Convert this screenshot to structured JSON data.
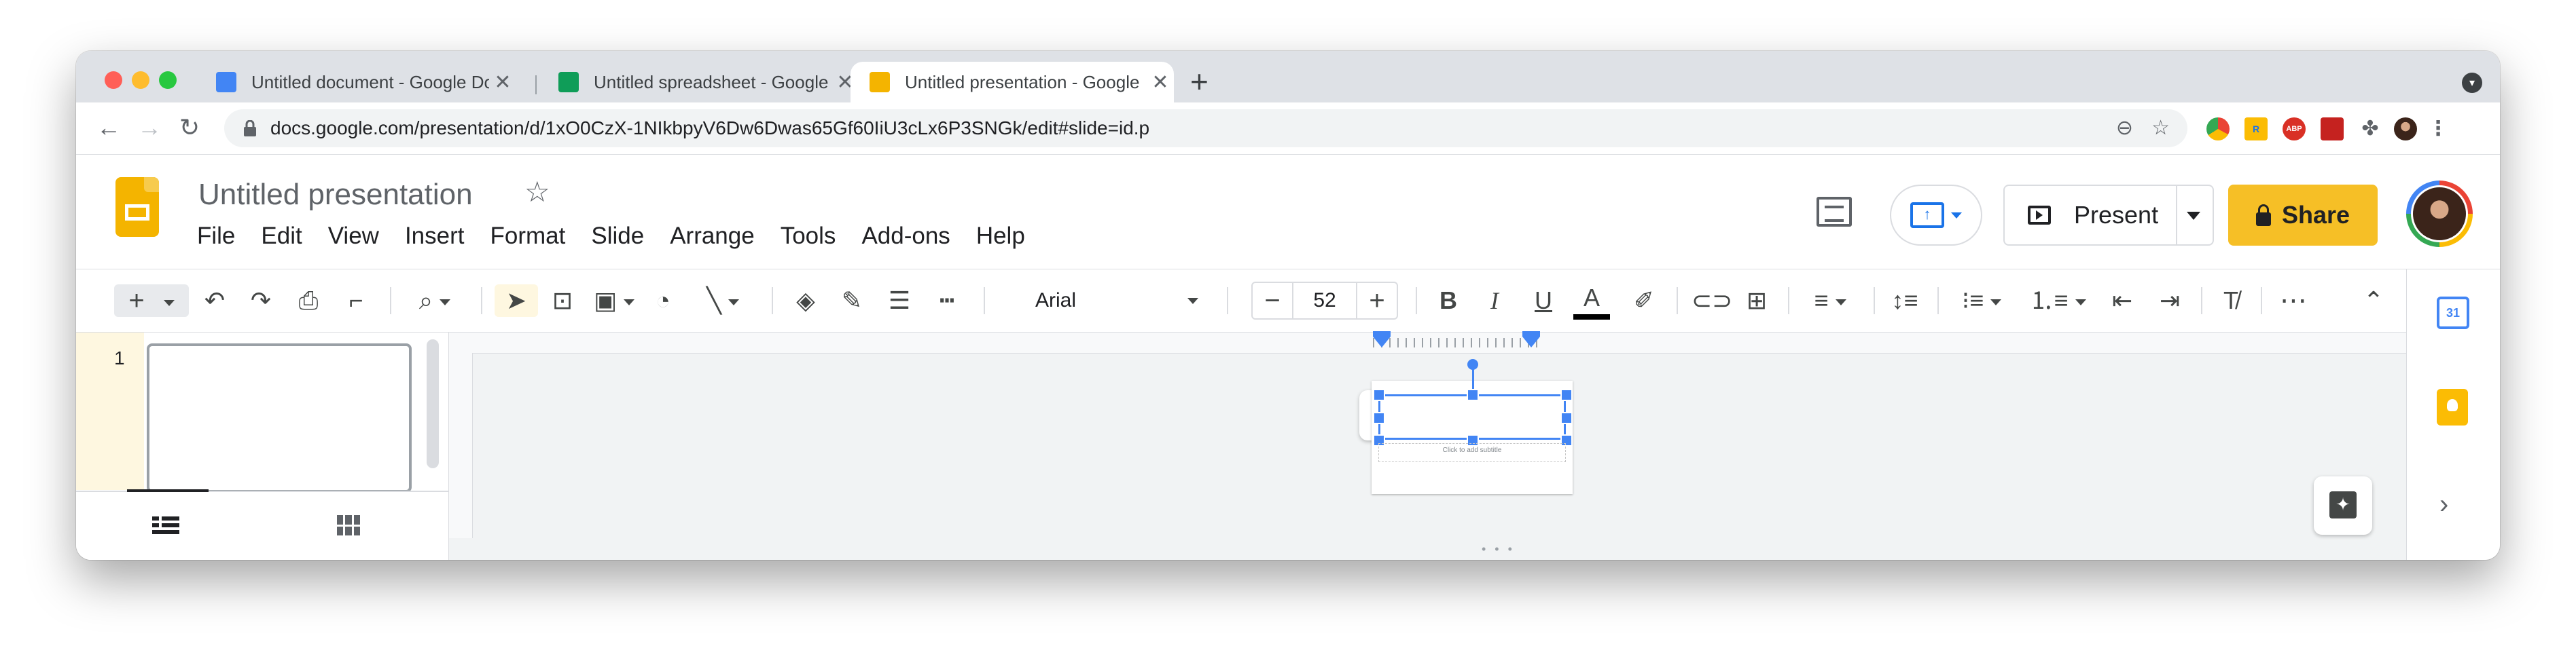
{
  "browser": {
    "tabs": [
      {
        "title": "Untitled document - Google Do",
        "color": "#4285f4"
      },
      {
        "title": "Untitled spreadsheet - Google",
        "color": "#0f9d58"
      },
      {
        "title": "Untitled presentation - Google",
        "color": "#f4b400",
        "active": true
      }
    ],
    "close_glyph": "✕",
    "new_tab": "+",
    "url": "docs.google.com/presentation/d/1xO0CzX-1NIkbpyV6Dw6Dwas65Gf60IiU3cLx6P3SNGk/edit#slide=id.p",
    "extensions": [
      "R",
      "ABP"
    ]
  },
  "app": {
    "title": "Untitled presentation",
    "menu": [
      "File",
      "Edit",
      "View",
      "Insert",
      "Format",
      "Slide",
      "Arrange",
      "Tools",
      "Add-ons",
      "Help"
    ],
    "present_label": "Present",
    "share_label": "Share",
    "meet_arrow": "↑",
    "calendar_day": "31"
  },
  "toolbar": {
    "font": "Arial",
    "font_size": "52",
    "minus": "−",
    "plus": "+",
    "bold": "B",
    "italic": "I",
    "underline": "U",
    "text_color": "A",
    "more": "⋯",
    "collapse": "⌃"
  },
  "filmstrip": {
    "slide_number": "1"
  },
  "slide": {
    "subtitle_placeholder": "Click to add subtitle"
  },
  "colors": {
    "accent": "#4285f4",
    "share": "#f6bf26",
    "slides_brand": "#f4b400"
  }
}
